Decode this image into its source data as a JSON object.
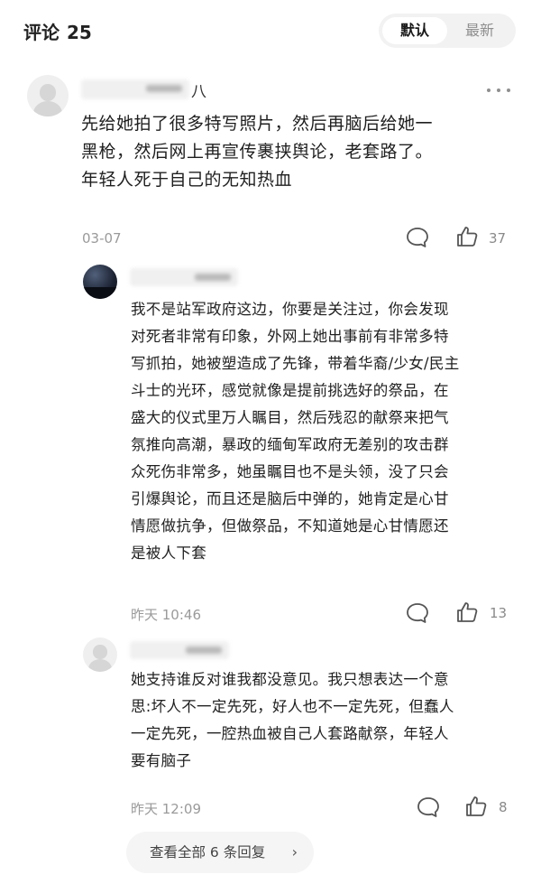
{
  "header": {
    "title": "评论",
    "count": "25",
    "sort_default": "默认",
    "sort_latest": "最新"
  },
  "comment": {
    "name_visible": "八",
    "text_lines": [
      "先给她拍了很多特写照片，然后再脑后给她一",
      "黑枪，然后网上再宣传裹挟舆论，老套路了。",
      "年轻人死于自己的无知热血"
    ],
    "time": "03-07",
    "likes": "37",
    "reply_icon": "comment-bubble-icon",
    "like_icon": "thumbs-up-icon",
    "more_icon": "more-dots-icon"
  },
  "replies": [
    {
      "text_lines": [
        "我不是站军政府这边，你要是关注过，你会发现",
        "对死者非常有印象，外网上她出事前有非常多特",
        "写抓拍，她被塑造成了先锋，带着华裔/少女/民主",
        "斗士的光环，感觉就像是提前挑选好的祭品，在",
        "盛大的仪式里万人瞩目，然后残忍的献祭来把气",
        "氛推向高潮，暴政的缅甸军政府无差别的攻击群",
        "众死伤非常多，她虽瞩目也不是头领，没了只会",
        "引爆舆论，而且还是脑后中弹的，她肯定是心甘",
        "情愿做抗争，但做祭品，不知道她是心甘情愿还",
        "是被人下套"
      ],
      "time": "昨天 10:46",
      "likes": "13"
    },
    {
      "text_lines": [
        "她支持谁反对谁我都没意见。我只想表达一个意",
        "思:坏人不一定先死，好人也不一定先死，但蠢人",
        "一定先死，一腔热血被自己人套路献祭，年轻人",
        "要有脑子"
      ],
      "time": "昨天 12:09",
      "likes": "8"
    }
  ],
  "view_all": {
    "label": "查看全部 6 条回复",
    "chevron": "›"
  }
}
